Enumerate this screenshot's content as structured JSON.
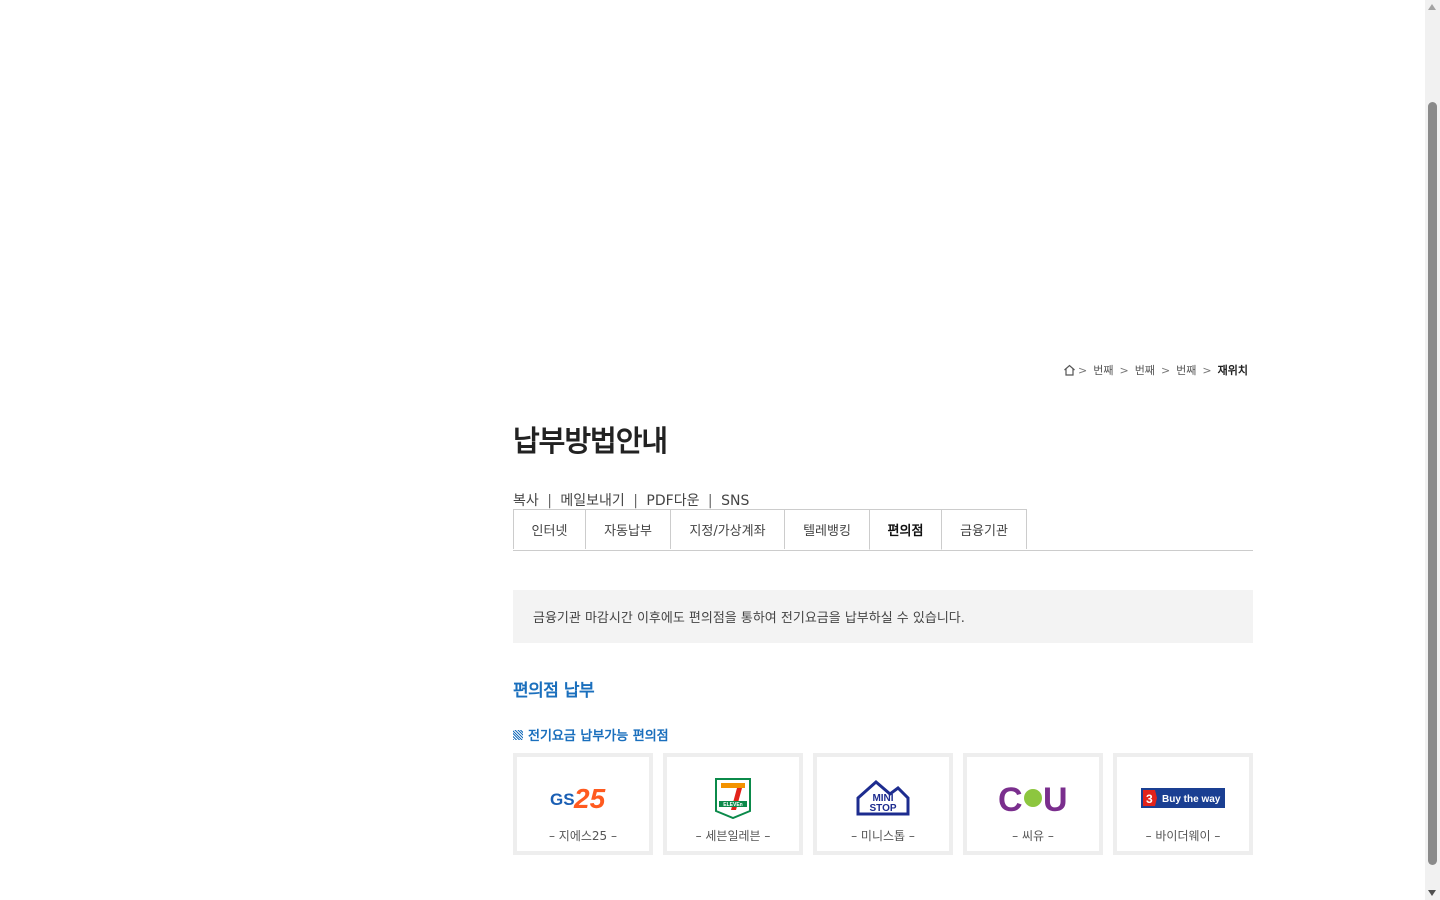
{
  "breadcrumb": {
    "items": [
      "번째",
      "번째",
      "번째"
    ],
    "current": "재위치"
  },
  "page": {
    "title": "납부방법안내"
  },
  "utility": {
    "copy": "복사",
    "email": "메일보내기",
    "pdf": "PDF다운",
    "sns": "SNS",
    "separator": "|"
  },
  "tabs": [
    {
      "label": "인터넷"
    },
    {
      "label": "자동납부"
    },
    {
      "label": "지정/가상계좌"
    },
    {
      "label": "텔레뱅킹"
    },
    {
      "label": "편의점",
      "active": true
    },
    {
      "label": "금융기관"
    }
  ],
  "notice": {
    "text": "금융기관 마감시간 이후에도 편의점을 통하여 전기요금을 납부하실 수 있습니다."
  },
  "section": {
    "title": "편의점 납부",
    "subtitle": "전기요금 납부가능 편의점"
  },
  "stores": [
    {
      "name": "– 지에스25 –",
      "logo_text": "GS25"
    },
    {
      "name": "– 세븐일레븐 –",
      "logo_text": "7 ELEVEN"
    },
    {
      "name": "– 미니스톱 –",
      "logo_text": "MINI STOP"
    },
    {
      "name": "– 씨유 –",
      "logo_text": "CU"
    },
    {
      "name": "– 바이더웨이 –",
      "logo_text": "Buy the way"
    }
  ],
  "colors": {
    "accent": "#1a6fbd",
    "notice_bg": "#f3f3f3",
    "border": "#cccccc"
  }
}
